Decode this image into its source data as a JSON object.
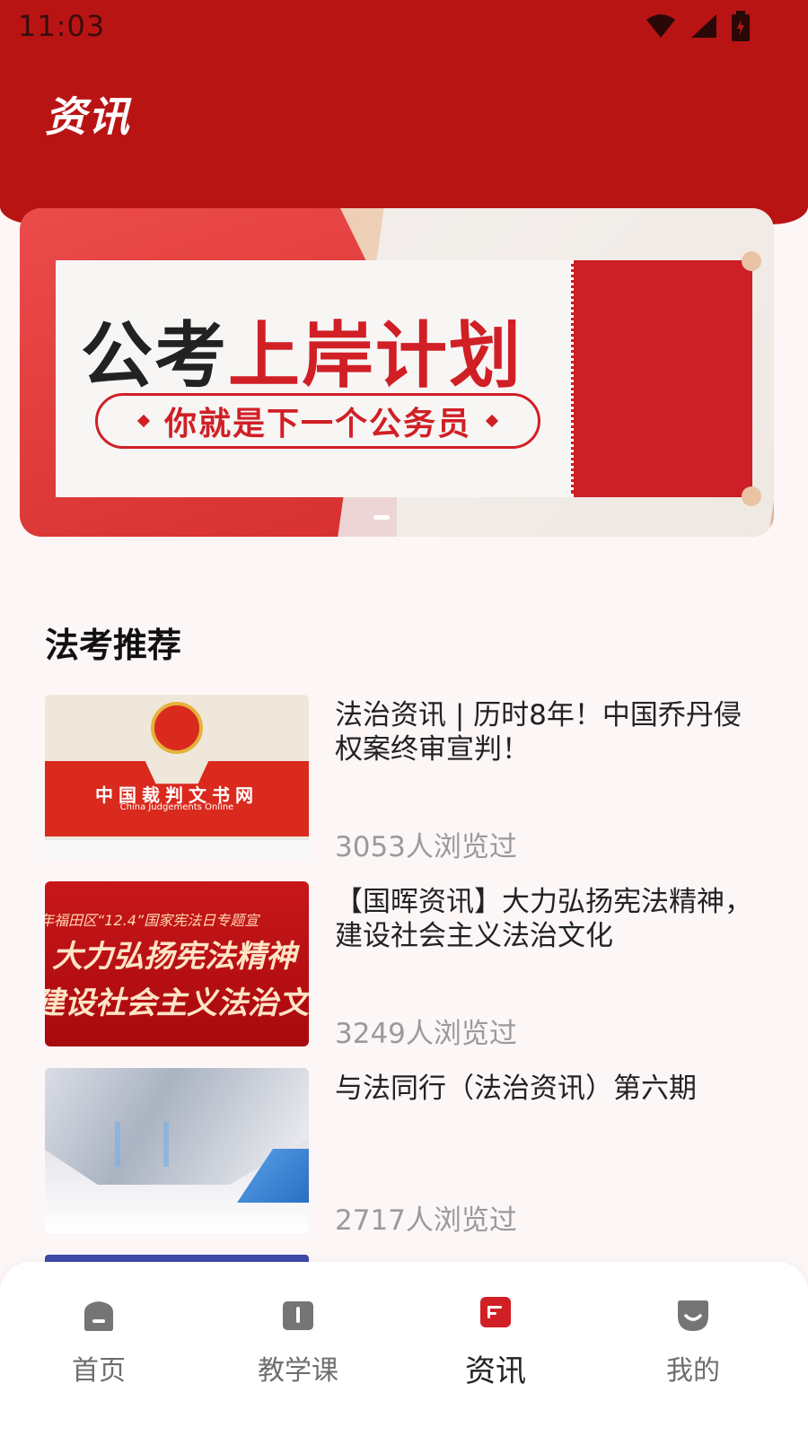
{
  "status_bar": {
    "time": "11:03"
  },
  "header": {
    "title": "资讯"
  },
  "banner": {
    "title_dark": "公考",
    "title_red": "上岸计划",
    "subtitle": "你就是下一个公务员"
  },
  "section": {
    "title": "法考推荐"
  },
  "news": [
    {
      "title": "法治资讯 | 历时8年！中国乔丹侵权案终审宣判！",
      "views": "3053人浏览过",
      "thumb_text": "中国裁判文书网",
      "thumb_text_en": "China Judgements Online"
    },
    {
      "title": "【国晖资讯】大力弘扬宪法精神，建设社会主义法治文化",
      "views": "3249人浏览过",
      "thumb_line1": "年福田区“12.4”国家宪法日专题宣",
      "thumb_line2": "大力弘扬宪法精神",
      "thumb_line3": "建设社会主义法治文",
      "thumb_caption": ""
    },
    {
      "title": "与法同行（法治资讯）第六期",
      "views": "2717人浏览过"
    }
  ],
  "bottom_nav": [
    {
      "label": "首页",
      "icon": "home-icon",
      "active": false
    },
    {
      "label": "教学课",
      "icon": "book-icon",
      "active": false
    },
    {
      "label": "资讯",
      "icon": "news-icon",
      "active": true
    },
    {
      "label": "我的",
      "icon": "profile-icon",
      "active": false
    }
  ],
  "colors": {
    "primary": "#b91414",
    "nav_active": "#d11f26",
    "nav_inactive": "#757575"
  }
}
